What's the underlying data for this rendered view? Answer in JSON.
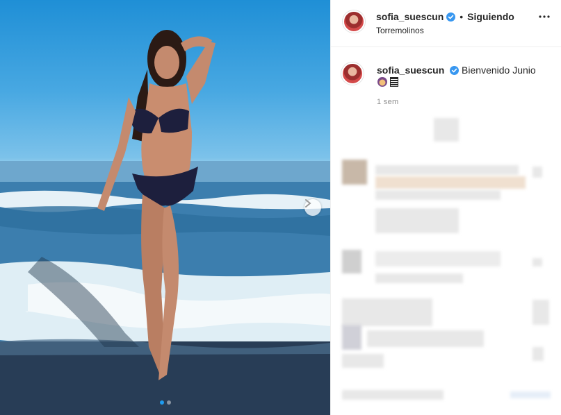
{
  "post": {
    "username": "sofia_suescun",
    "separator": "•",
    "follow_status": "Siguiendo",
    "location": "Torremolinos",
    "caption_username": "sofia_suescun",
    "caption_text": "Bienvenido Junio",
    "time": "1 sem"
  },
  "photo": {
    "carousel_count": 2,
    "carousel_active": 1
  },
  "icons": {
    "verified": "verified-badge-icon",
    "more": "more-options-icon",
    "next": "chevron-right-icon"
  },
  "colors": {
    "verified": "#3897f0",
    "carousel_active": "#1e9cf0",
    "muted_text": "#8e8e8e"
  }
}
